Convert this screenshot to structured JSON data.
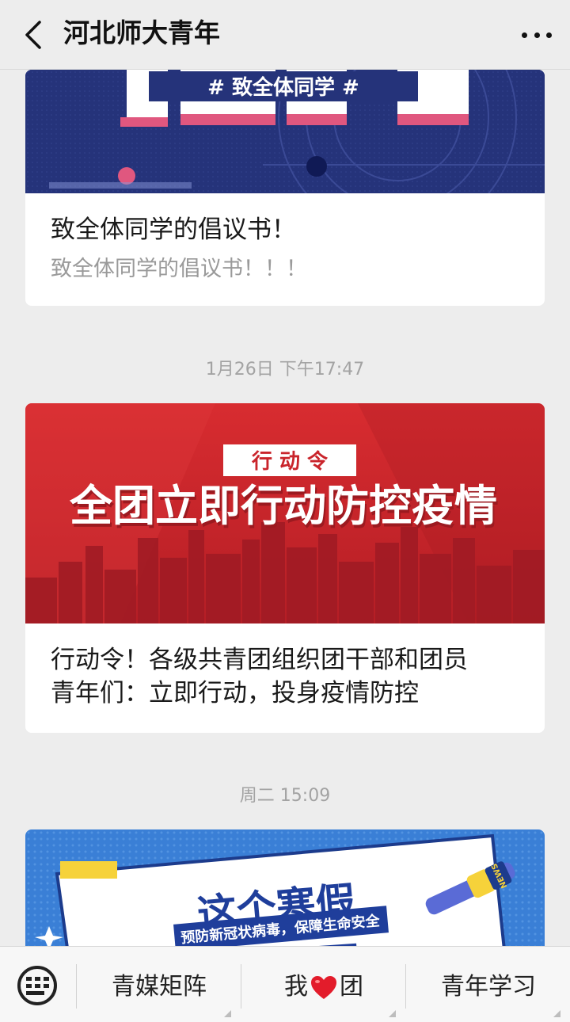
{
  "header": {
    "title": "河北师大青年"
  },
  "feed": [
    {
      "cover_text": "# 致全体同学 #",
      "title": "致全体同学的倡议书！",
      "description": "致全体同学的倡议书！！！"
    },
    {
      "time": "1月26日 下午17:47",
      "cover_badge": "行 动 令",
      "cover_headline": "全团立即行动防控疫情",
      "title_line1": "行动令！各级共青团组织团干部和团员",
      "title_line2": "青年们：立即行动，投身疫情防控"
    },
    {
      "time": "周二 15:09",
      "cover_headline": "这个寒假",
      "cover_subline": "预防新冠状病毒，保障生命安全",
      "cover_tag": "NEWS"
    }
  ],
  "menu": {
    "items": [
      "青媒矩阵",
      "我",
      "团",
      "青年学习"
    ]
  },
  "colors": {
    "background": "#ededed",
    "card_red": "#c9242b",
    "card_navy": "#25337a",
    "card_blue": "#3a7fd6"
  },
  "icons": [
    "back-arrow-icon",
    "more-dots-icon",
    "keyboard-icon",
    "heart-icon",
    "microphone-icon"
  ]
}
